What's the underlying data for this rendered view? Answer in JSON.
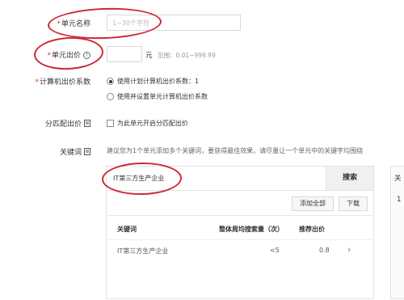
{
  "form": {
    "unit_name": {
      "required_mark": "*",
      "label": "单元名称",
      "placeholder": "1~30个字符",
      "value": ""
    },
    "unit_bid": {
      "required_mark": "*",
      "label": "单元出价",
      "help_icon": "?",
      "value": "",
      "suffix": "元",
      "range": "范围：0.01~999.99"
    },
    "computer_bid_ratio": {
      "required_mark": "*",
      "label": "计算机出价系数",
      "options": [
        {
          "label": "使用计划计算机出价系数：1",
          "selected": true
        },
        {
          "label": "使用并设置单元计算机出价系数",
          "selected": false
        }
      ]
    },
    "match_bid": {
      "label": "分匹配出价",
      "checkbox_label": "为此单元开启分匹配出价",
      "checked": false
    },
    "keywords": {
      "label": "关键词",
      "hint": "建议您为1个单元添加多个关键词，要获得最佳效果，请尽量让一个单元中的关键字均围绕",
      "search_value": "IT第三方生产企业",
      "search_button": "搜索",
      "add_all_button": "添加全部",
      "download_button": "下载",
      "side_panel_header": "关",
      "side_panel_value": "1"
    }
  },
  "table": {
    "headers": [
      "关键词",
      "整体周均搜索量（次）",
      "推荐出价"
    ],
    "rows": [
      {
        "keyword": "IT第三方生产企业",
        "volume": "<5",
        "bid": "0.8",
        "action": "›"
      }
    ]
  },
  "colors": {
    "annotation_oval": "#cc2936",
    "required": "#e4393c"
  }
}
